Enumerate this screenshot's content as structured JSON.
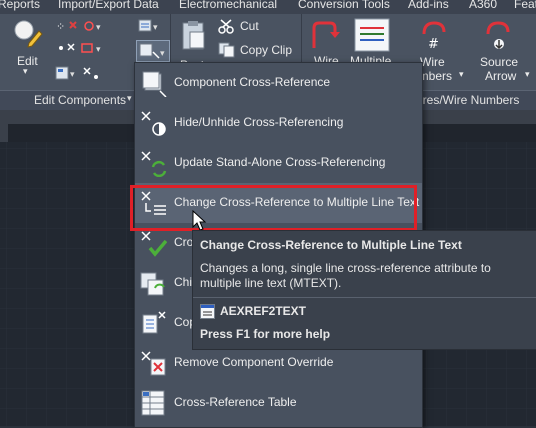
{
  "ribbon": {
    "tabs": [
      "Reports",
      "Import/Export Data",
      "Electromechanical",
      "Conversion Tools",
      "Add-ins",
      "A360",
      "Feat"
    ],
    "edit_label": "Edit",
    "cut_label": "Cut",
    "copy_clip_label": "Copy Clip",
    "paste_label": "Paste",
    "wire_label": "Wire",
    "multiple_label": "Multiple",
    "wire_numbers_label": "Wire\nNumbers",
    "source_arrow_label": "Source\nArrow",
    "panel_edit_components": "Edit Components",
    "panel_wires": "Wires/Wire Numbers"
  },
  "menu": {
    "items": [
      {
        "label": "Component Cross-Reference",
        "icon": "component-crossref-icon"
      },
      {
        "label": "Hide/Unhide Cross-Referencing",
        "icon": "hide-unhide-icon"
      },
      {
        "label": "Update Stand-Alone Cross-Referencing",
        "icon": "update-standalone-icon"
      },
      {
        "label": "Change Cross-Reference to Multiple Line Text",
        "icon": "change-to-multiline-icon"
      },
      {
        "label": "Cro",
        "icon": "check-crossref-icon"
      },
      {
        "label": "Chi",
        "icon": "child-component-icon"
      },
      {
        "label": "Cop",
        "icon": "copy-catalog-icon"
      },
      {
        "label": "Remove Component Override",
        "icon": "remove-override-icon"
      },
      {
        "label": "Cross-Reference Table",
        "icon": "crossref-table-icon"
      }
    ]
  },
  "tooltip": {
    "title": "Change Cross-Reference to Multiple Line Text",
    "description": "Changes a long, single line cross-reference attribute to multiple line text (MTEXT).",
    "command": "AEXREF2TEXT",
    "help": "Press F1 for more help"
  },
  "colors": {
    "highlight_border": "#e02027",
    "ribbon_bg": "#4a5361",
    "menu_bg": "#48515f",
    "canvas_bg": "#222831"
  }
}
